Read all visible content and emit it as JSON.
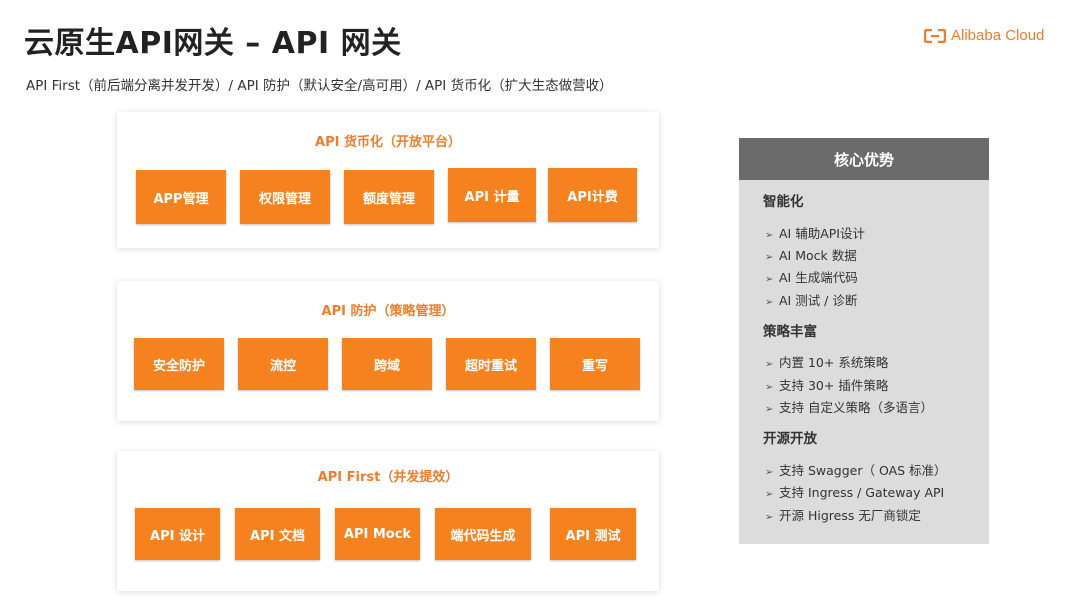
{
  "header": {
    "title": "云原生API网关 – API 网关",
    "subtitle": "API First（前后端分离并发开发）/ API 防护（默认安全/高可用）/ API 货币化（扩大生态做营收）",
    "logo_text": "Alibaba Cloud"
  },
  "colors": {
    "accent": "#f5821f",
    "panel_title": "#f07d2b",
    "side_header": "#6b6b6b",
    "side_bg": "#dcdcdc"
  },
  "panels": [
    {
      "title": "API 货币化（开放平台）",
      "boxes": [
        "APP管理",
        "权限管理",
        "额度管理",
        "API 计量",
        "API计费"
      ]
    },
    {
      "title": "API 防护（策略管理）",
      "boxes": [
        "安全防护",
        "流控",
        "跨域",
        "超时重试",
        "重写"
      ]
    },
    {
      "title": "API First（并发提效）",
      "boxes": [
        "API 设计",
        "API 文档",
        "API Mock",
        "端代码生成",
        "API 测试"
      ]
    }
  ],
  "advantages": {
    "header": "核心优势",
    "arrow_glyph": "➢",
    "sections": [
      {
        "title": "智能化",
        "items": [
          "AI 辅助API设计",
          "AI Mock 数据",
          "AI 生成端代码",
          "AI 测试 / 诊断"
        ]
      },
      {
        "title": "策略丰富",
        "items": [
          "内置 10+ 系统策略",
          "支持 30+ 插件策略",
          "支持 自定义策略（多语言）"
        ]
      },
      {
        "title": "开源开放",
        "items": [
          "支持 Swagger（ OAS 标准）",
          "支持 Ingress / Gateway API",
          "开源 Higress 无厂商锁定"
        ]
      }
    ]
  }
}
